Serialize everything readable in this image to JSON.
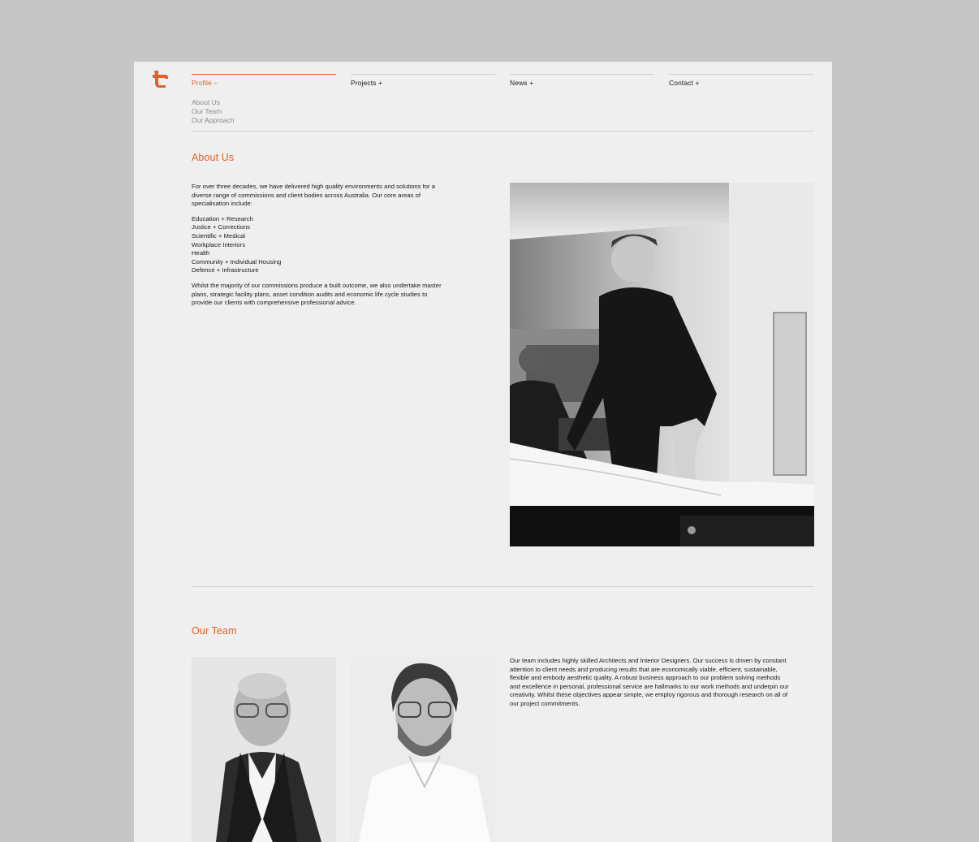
{
  "brand": {
    "logo_icon": "t-logo-icon",
    "accent_color": "#e0622a"
  },
  "nav": {
    "items": [
      {
        "label": "Profile –"
      },
      {
        "label": "Projects +"
      },
      {
        "label": "News +"
      },
      {
        "label": "Contact +"
      }
    ],
    "profile_submenu": [
      "About Us",
      "Our Team",
      "Our Approach"
    ]
  },
  "about": {
    "title": "About Us",
    "intro": "For over three decades, we have delivered high quality environments and solutions for a diverse range of commissions and client bodies across Australia. Our core areas of specialisation include:",
    "specialisations": [
      "Education + Research",
      "Justice + Corrections",
      "Scientific + Medical",
      "Workplace Interiors",
      "Health",
      "Community + Individual Housing",
      "Defence + Infrastructure"
    ],
    "closing": "Whilst the majority of our commissions produce a built outcome, we also undertake master plans, strategic facility plans, asset condition audits and economic life cycle studies to provide our clients with comprehensive professional advice."
  },
  "team": {
    "title": "Our Team",
    "description": "Our team includes highly skilled Architects and Interior Designers. Our success is driven by constant attention to client needs and producing results that are economically viable, efficient, sustainable, flexible and embody aesthetic quality. A robust business approach to our problem solving methods and excellence in personal, professional service are hallmarks to our work methods and underpin our creativity. Whilst these objectives appear simple, we employ rigorous and thorough research on all of our project commitments."
  }
}
